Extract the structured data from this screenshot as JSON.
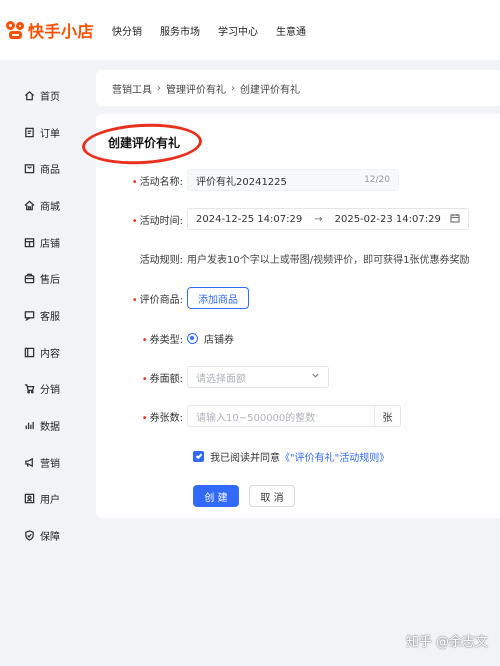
{
  "app": {
    "logo_text": "快手小店"
  },
  "topnav": [
    "快分销",
    "服务市场",
    "学习中心",
    "生意通"
  ],
  "sidebar": [
    {
      "label": "首页",
      "icon": "home-icon"
    },
    {
      "label": "订单",
      "icon": "order-icon"
    },
    {
      "label": "商品",
      "icon": "goods-icon"
    },
    {
      "label": "商城",
      "icon": "mall-icon"
    },
    {
      "label": "店铺",
      "icon": "store-icon"
    },
    {
      "label": "售后",
      "icon": "after-sales-icon"
    },
    {
      "label": "客服",
      "icon": "customer-service-icon"
    },
    {
      "label": "内容",
      "icon": "content-icon"
    },
    {
      "label": "分销",
      "icon": "distribution-icon"
    },
    {
      "label": "数据",
      "icon": "data-icon"
    },
    {
      "label": "营销",
      "icon": "marketing-icon"
    },
    {
      "label": "用户",
      "icon": "user-icon"
    },
    {
      "label": "保障",
      "icon": "shield-icon"
    }
  ],
  "breadcrumb": [
    "营销工具",
    "管理评价有礼",
    "创建评价有礼"
  ],
  "form": {
    "title": "创建评价有礼",
    "name_label": "活动名称:",
    "name_value": "评价有礼20241225",
    "name_count": "12/20",
    "time_label": "活动时间:",
    "time_start": "2024-12-25 14:07:29",
    "time_arrow": "→",
    "time_end": "2025-02-23 14:07:29",
    "rules_label": "活动规则:",
    "rules_text": "用户发表10个字以上或带图/视频评价，即可获得1张优惠券奖励",
    "goods_label": "评价商品:",
    "goods_button": "添加商品",
    "coupon_type_label": "券类型:",
    "coupon_type_value": "店铺券",
    "coupon_amount_label": "券面额:",
    "coupon_amount_placeholder": "请选择面额",
    "coupon_count_label": "券张数:",
    "coupon_count_placeholder": "请输入10~500000的整数",
    "coupon_count_suffix": "张",
    "agree_text": "我已阅读并同意",
    "agree_link": "《\"评价有礼\"活动规则》",
    "create_button": "创 建",
    "cancel_button": "取 消"
  },
  "watermark": "知乎 @余志文",
  "colors": {
    "brand": "#ff5000",
    "primary": "#326bfb",
    "annotation": "#e8301c"
  }
}
